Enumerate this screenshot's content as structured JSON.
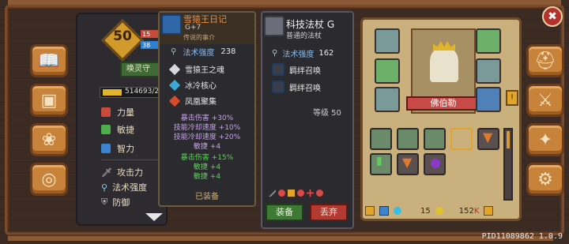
{
  "player": {
    "level": "50",
    "level_sub1": "15",
    "level_sub2": "38",
    "soul_button": "唤灵守",
    "xp_text": "514693/2"
  },
  "stats_primary": [
    {
      "label": "力量",
      "color": "#c84a3a"
    },
    {
      "label": "敏捷",
      "color": "#4fae4a"
    },
    {
      "label": "智力",
      "color": "#3a84d0"
    }
  ],
  "stats_secondary": [
    {
      "label": "攻击力",
      "icon": "sword-icon"
    },
    {
      "label": "法术强度",
      "icon": "wand-icon"
    },
    {
      "label": "防御",
      "icon": "shield-icon"
    }
  ],
  "item1": {
    "name": "雪猿王日记",
    "sub": "G+7",
    "desc": "传说的事介",
    "stat_label": "法术强度",
    "stat_value": "238",
    "gems": [
      {
        "label": "雪猿王之魂",
        "color": "#d8d8e0"
      },
      {
        "label": "冰冷核心",
        "color": "#39a9d8"
      },
      {
        "label": "凤凰聚集",
        "color": "#d84a2a"
      }
    ],
    "bonuses_white": [
      "暴击伤害 +30%",
      "技能冷却速度 +10%",
      "技能冷却速度 +20%",
      "敏捷 +4"
    ],
    "bonuses_green": [
      "暴击伤害 +15%",
      "敏捷 +4",
      "敏捷 +4"
    ],
    "status": "已装备"
  },
  "item2": {
    "name": "科技法杖",
    "grade": "G",
    "sub": "普通的法杖",
    "stat_label": "法术强度",
    "stat_value": "162",
    "skills": [
      "羁绊召唤",
      "羁绊召唤"
    ],
    "level_text": "等级 50",
    "equip_button": "装备",
    "drop_button": "丢弃"
  },
  "character": {
    "name": "佛伯勒"
  },
  "currency": {
    "gems": "15",
    "gold": "152",
    "gold_suffix": "K"
  },
  "badge": "!",
  "pid": "PID11089862 1.0.9"
}
